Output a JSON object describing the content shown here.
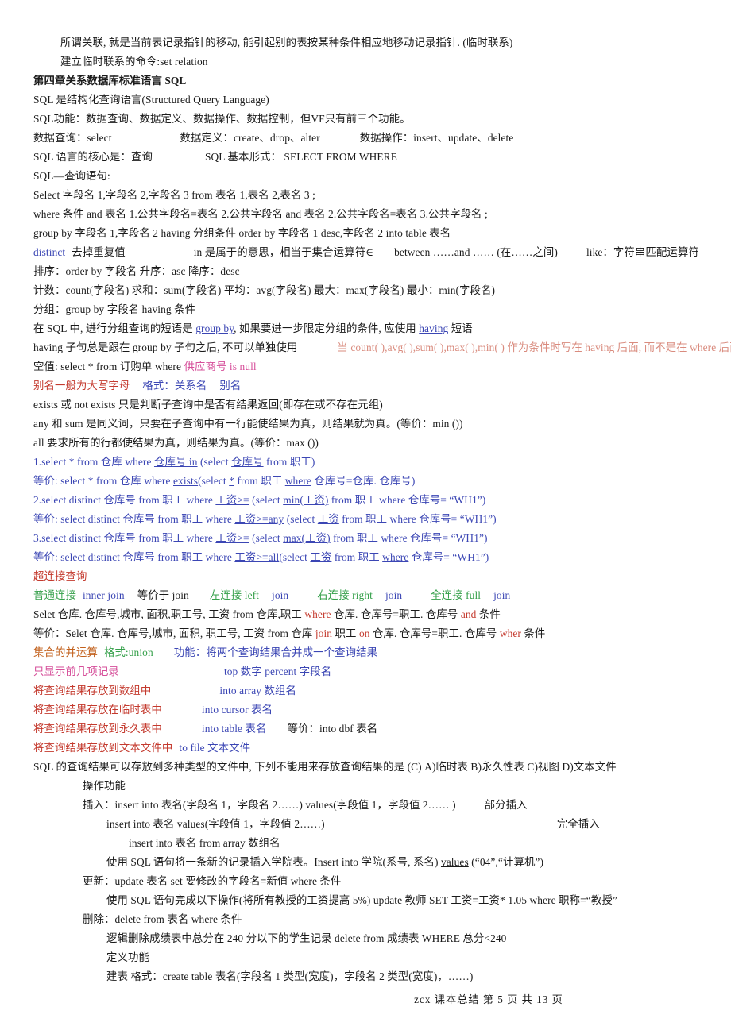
{
  "document": {
    "footer": "zcx 课本总结  第 5 页 共 13 页",
    "heading": "第四章关系数据库标准语言 SQL"
  },
  "lines": {
    "l01": "所谓关联, 就是当前表记录指针的移动, 能引起别的表按某种条件相应地移动记录指针. (临时联系)",
    "l02": "建立临时联系的命令:set   relation",
    "l03": "第四章关系数据库标准语言 SQL",
    "l04": "SQL 是结构化查询语言(Structured Query Language)",
    "l05": "SQL功能：数据查询、数据定义、数据操作、数据控制，但VF只有前三个功能。",
    "l06a": "数据查询：select",
    "l06b": "数据定义：create、drop、alter",
    "l06c": "数据操作：insert、update、delete",
    "l07a": "SQL 语言的核心是：查询",
    "l07b": "SQL 基本形式： SELECT   FROM   WHERE",
    "l08": "SQL—查询语句:",
    "l09": "Select  字段名 1,字段名 2,字段名 3  from 表名 1,表名 2,表名 3  ;",
    "l10": "where 条件 and 表名 1.公共字段名=表名 2.公共字段名 and 表名 2.公共字段名=表名 3.公共字段名 ;",
    "l11": "group  by  字段名 1,字段名 2  having  分组条件 order by 字段名 1 desc,字段名 2  into  table  表名",
    "l12a": "distinct",
    "l12b": "去掉重复值",
    "l12c": "in 是属于的意思，相当于集合运算符∈",
    "l12d": "between ……and …… (在……之间)",
    "l12e": "like：字符串匹配运算符",
    "l13": "排序：order  by 字段名   升序：asc   降序：desc",
    "l14": "计数：count(字段名)  求和：sum(字段名)  平均：avg(字段名)  最大：max(字段名)  最小：min(字段名)",
    "l15": "分组：group  by 字段名  having 条件",
    "l16a": "在 SQL 中, 进行分组查询的短语是 ",
    "l16b": "group   by",
    "l16c": ", 如果要进一步限定分组的条件, 应使用 ",
    "l16d": "having",
    "l16e": " 短语",
    "l17a": "having 子句总是跟在 group by 子句之后, 不可以单独使用",
    "l17b": "当 count( ),avg( ),sum( ),max( ),min( ) 作为条件时写在 having 后面, 而不是在 where 后面",
    "l18a": "空值: select * from 订购单 where ",
    "l18b": "供应商号",
    "l18c": " is null",
    "l19a": "别名一般为大写字母",
    "l19b": "格式：关系名",
    "l19c": "别名",
    "l20": "exists 或 not exists 只是判断子查询中是否有结果返回(即存在或不存在元组)",
    "l21": "any 和 sum 是同义词，只要在子查询中有一行能使结果为真，则结果就为真。(等价：min ())",
    "l22": "all 要求所有的行都使结果为真，则结果为真。(等价：max ())",
    "l23a": "1.select * from 仓库 where ",
    "l23b": "仓库号  in",
    "l23c": " (select ",
    "l23d": "仓库号",
    "l23e": " from 职工)",
    "l24a": "等价: select * from 仓库 where ",
    "l24b": "exists",
    "l24c": "(select ",
    "l24d": "*",
    "l24e": " from 职工 ",
    "l24f": "where",
    "l24g": " 仓库号=仓库. 仓库号)",
    "l25a": "2.select distinct 仓库号 from 职工 where ",
    "l25b": "工资>=",
    "l25c": " (select ",
    "l25d": "min(工资)",
    "l25e": " from 职工 where 仓库号= “WH1”)",
    "l26a": "等价: select distinct 仓库号 from 职工 where ",
    "l26b": "工资>=any",
    "l26c": " (select ",
    "l26d": "工资",
    "l26e": " from 职工 where 仓库号= “WH1”)",
    "l27a": "3.select distinct 仓库号 from 职工 where ",
    "l27b": "工资>=",
    "l27c": " (select ",
    "l27d": "max(工资)",
    "l27e": " from 职工 where 仓库号= “WH1”)",
    "l28a": "等价: select distinct 仓库号 from 职工 where ",
    "l28b": "工资>=all",
    "l28c": "(select ",
    "l28d": "工资",
    "l28e": " from 职工 ",
    "l28f": "where",
    "l28g": " 仓库号= “WH1”)",
    "l29": "超连接查询",
    "l30a": "普通连接",
    "l30b": "inner  join",
    "l30c": "等价于 join",
    "l30d": "左连接 left",
    "l30e": "join",
    "l30f": "右连接 right",
    "l30g": "join",
    "l30h": "全连接 full",
    "l30i": "join",
    "l31a": "Selet 仓库. 仓库号,城市, 面积,职工号, 工资 from 仓库,职工 ",
    "l31b": "where",
    "l31c": " 仓库. 仓库号=职工. 仓库号 ",
    "l31d": "and",
    "l31e": " 条件",
    "l32a": "等价：Selet 仓库. 仓库号,城市, 面积, 职工号, 工资 from 仓库 ",
    "l32b": "join",
    "l32c": " 职工 ",
    "l32d": "on",
    "l32e": " 仓库. 仓库号=职工. 仓库号 ",
    "l32f": "wher",
    "l32g": " 条件",
    "l33a": "集合的并运算",
    "l33b": "格式:union",
    "l33c": "功能：将两个查询结果合并成一个查询结果",
    "l34a": "只显示前几项记录",
    "l34b": "top 数字 percent 字段名",
    "l35a": "将查询结果存放到数组中",
    "l35b": "into array 数组名",
    "l36a": "将查询结果存放在临时表中",
    "l36b": "into cursor 表名",
    "l37a": "将查询结果存放到永久表中",
    "l37b": "into table 表名",
    "l37c": "等价：into  dbf  表名",
    "l38a": "将查询结果存放到文本文件中",
    "l38b": "to file 文本文件",
    "l39": "SQL 的查询结果可以存放到多种类型的文件中, 下列不能用来存放查询结果的是 (C)    A)临时表 B)永久性表 C)视图 D)文本文件",
    "l40": "操作功能",
    "l41a": "插入：insert into 表名(字段名 1，字段名 2……) values(字段值 1，字段值 2…… )",
    "l41b": "部分插入",
    "l42a": "insert into 表名 values(字段值 1，字段值 2……)",
    "l42b": "完全插入",
    "l43": "insert  into 表名 from  array 数组名",
    "l44a": "使用 SQL 语句将一条新的记录插入学院表。Insert  into 学院(系号, 系名) ",
    "l44b": "values",
    "l44c": "  (“04”,“计算机”)",
    "l45": "更新：update  表名 set 要修改的字段名=新值 where  条件",
    "l46a": "使用 SQL 语句完成以下操作(将所有教授的工资提高 5%) ",
    "l46b": "update",
    "l46c": " 教师 SET 工资=工资* 1.05 ",
    "l46d": "where",
    "l46e": " 职称=“教授”",
    "l47": "删除：delete  from  表名 where 条件",
    "l48a": "逻辑删除成绩表中总分在 240 分以下的学生记录  delete  ",
    "l48b": "from",
    "l48c": " 成绩表 WHERE 总分<240",
    "l49": "定义功能",
    "l50": "建表  格式：create table 表名(字段名 1 类型(宽度)，字段名 2 类型(宽度)，……)"
  },
  "colors": {
    "blue": "#3b46b4",
    "red": "#c43a2e",
    "pink": "#e08b9a",
    "magenta": "#d64f9a",
    "green": "#35a04a",
    "orange": "#c2601c",
    "black": "#1a1a1a"
  }
}
